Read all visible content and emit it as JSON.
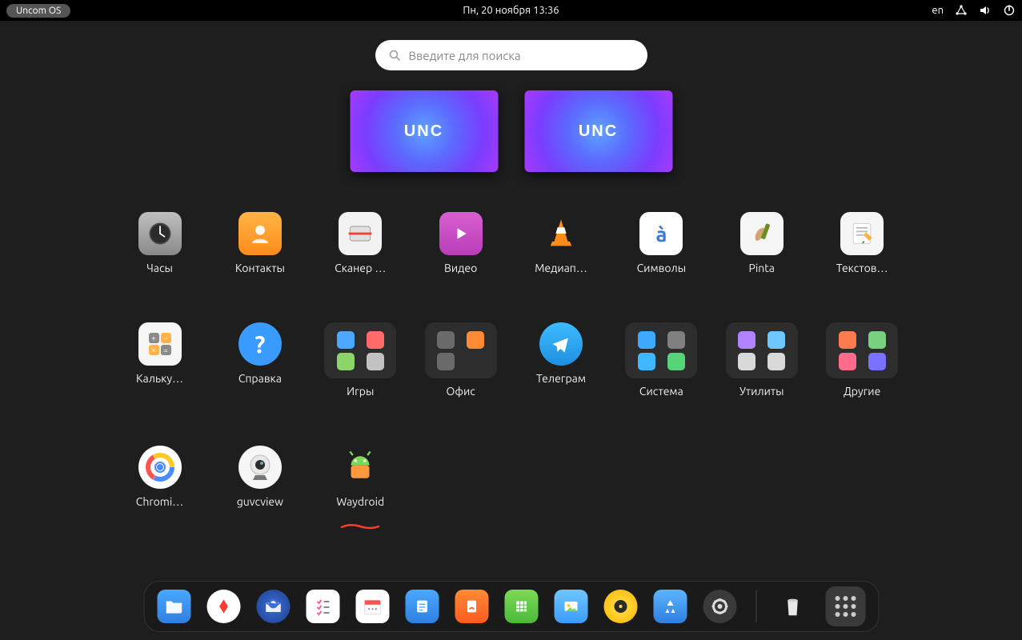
{
  "topbar": {
    "os_label": "Uncom OS",
    "datetime": "Пн, 20 ноября  13:36",
    "lang": "en"
  },
  "search": {
    "placeholder": "Введите для поиска"
  },
  "workspaces": [
    {
      "logo": "UNC"
    },
    {
      "logo": "UNC"
    }
  ],
  "apps": [
    {
      "key": "clock",
      "label": "Часы",
      "icon": "clock",
      "folder": false
    },
    {
      "key": "contacts",
      "label": "Контакты",
      "icon": "contacts",
      "folder": false
    },
    {
      "key": "scanner",
      "label": "Сканер …",
      "icon": "scanner",
      "folder": false
    },
    {
      "key": "video",
      "label": "Видео",
      "icon": "video",
      "folder": false
    },
    {
      "key": "media",
      "label": "Медиап…",
      "icon": "vlc",
      "folder": false
    },
    {
      "key": "symbols",
      "label": "Символы",
      "icon": "symbols",
      "folder": false
    },
    {
      "key": "pinta",
      "label": "Pinta",
      "icon": "pinta",
      "folder": false
    },
    {
      "key": "texted",
      "label": "Текстов…",
      "icon": "textedit",
      "folder": false
    },
    {
      "key": "calc",
      "label": "Кальку…",
      "icon": "calc",
      "folder": false
    },
    {
      "key": "help",
      "label": "Справка",
      "icon": "help",
      "folder": false
    },
    {
      "key": "games",
      "label": "Игры",
      "icon": "folder-games",
      "folder": true,
      "minis": [
        "#4aa8ff",
        "#ff6b6b",
        "#8bd56b",
        "#c2c2c2"
      ]
    },
    {
      "key": "office",
      "label": "Офис",
      "icon": "folder-office",
      "folder": true,
      "minis": [
        "#6a6a6a",
        "#ff8a34",
        "#6a6a6a",
        ""
      ]
    },
    {
      "key": "telegram",
      "label": "Телеграм",
      "icon": "telegram",
      "folder": false
    },
    {
      "key": "system",
      "label": "Система",
      "icon": "folder-system",
      "folder": true,
      "minis": [
        "#3fa8ff",
        "#808080",
        "#3fb8ff",
        "#57d479"
      ]
    },
    {
      "key": "utils",
      "label": "Утилиты",
      "icon": "folder-utils",
      "folder": true,
      "minis": [
        "#b183ff",
        "#6fc7ff",
        "#d9d9d9",
        "#d9d9d9"
      ]
    },
    {
      "key": "other",
      "label": "Другие",
      "icon": "folder-other",
      "folder": true,
      "minis": [
        "#ff7b4e",
        "#79d07e",
        "#ff6b8a",
        "#7a72ff"
      ]
    },
    {
      "key": "chromium",
      "label": "Chromi…",
      "icon": "chromium",
      "folder": false
    },
    {
      "key": "guvcview",
      "label": "guvcview",
      "icon": "webcam",
      "folder": false
    },
    {
      "key": "waydroid",
      "label": "Waydroid",
      "icon": "waydroid",
      "folder": false,
      "underline": true
    }
  ],
  "dock": [
    {
      "key": "files",
      "name": "files-icon"
    },
    {
      "key": "yandex",
      "name": "browser-icon"
    },
    {
      "key": "tbird",
      "name": "mail-icon"
    },
    {
      "key": "todo",
      "name": "todo-icon"
    },
    {
      "key": "calendar",
      "name": "calendar-icon"
    },
    {
      "key": "notes",
      "name": "notes-icon"
    },
    {
      "key": "docs",
      "name": "document-icon"
    },
    {
      "key": "sheets",
      "name": "spreadsheet-icon"
    },
    {
      "key": "photos",
      "name": "photos-icon"
    },
    {
      "key": "rhythmbox",
      "name": "music-icon"
    },
    {
      "key": "store",
      "name": "appstore-icon"
    },
    {
      "key": "settings",
      "name": "settings-icon"
    }
  ]
}
